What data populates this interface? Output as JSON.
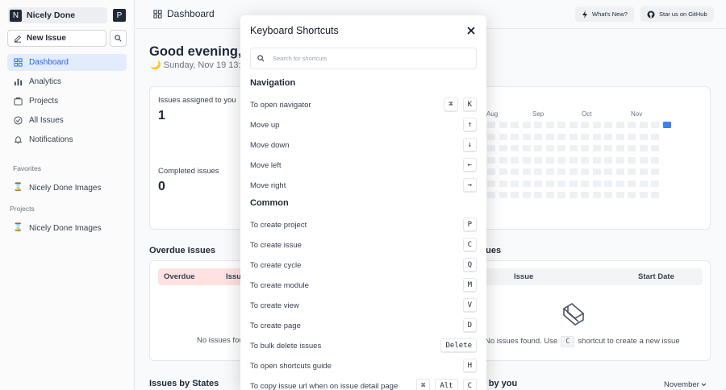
{
  "sidebar": {
    "workspace": {
      "initial": "N",
      "name": "Nicely Done"
    },
    "user_initial": "P",
    "new_issue": "New Issue",
    "nav": [
      {
        "label": "Dashboard",
        "icon": "grid-icon",
        "active": true
      },
      {
        "label": "Analytics",
        "icon": "bar-chart-icon"
      },
      {
        "label": "Projects",
        "icon": "briefcase-icon"
      },
      {
        "label": "All Issues",
        "icon": "check-circle-icon"
      },
      {
        "label": "Notifications",
        "icon": "bell-icon"
      }
    ],
    "favorites_label": "Favorites",
    "favorites": [
      {
        "label": "Nicely Done Images",
        "icon": "hourglass-icon"
      }
    ],
    "projects_label": "Projects",
    "projects": [
      {
        "label": "Nicely Done Images",
        "icon": "hourglass-icon"
      }
    ]
  },
  "topbar": {
    "title": "Dashboard",
    "whats_new": "What's New?",
    "github": "Star us on GitHub"
  },
  "dashboard": {
    "greeting": "Good evening, B",
    "date": "Sunday, Nov 19 13:38",
    "assigned_label": "Issues assigned to you",
    "assigned_value": "1",
    "completed_label": "Completed issues",
    "completed_value": "0",
    "months": [
      "Aug",
      "Sep",
      "Oct",
      "Nov"
    ],
    "heatmap_accent": "#3b82f6",
    "overdue_title": "Overdue Issues",
    "overdue_cols": [
      "Overdue",
      "Issue"
    ],
    "overdue_empty": "No issues found",
    "upcoming_title_fragment": "sues",
    "upcoming_cols": [
      "Issue",
      "Start Date"
    ],
    "upcoming_empty_pre": "No issues found. Use",
    "upcoming_empty_key": "C",
    "upcoming_empty_post": "shortcut to create a new issue",
    "states_title": "Issues by States",
    "by_you_fragment": "d by you",
    "month_select": "November"
  },
  "modal": {
    "title": "Keyboard Shortcuts",
    "search_placeholder": "Search for shortcuts",
    "groups": [
      {
        "title": "Navigation",
        "items": [
          {
            "label": "To open navigator",
            "keys": [
              "⌘",
              "K"
            ]
          },
          {
            "label": "Move up",
            "keys": [
              "↑"
            ]
          },
          {
            "label": "Move down",
            "keys": [
              "↓"
            ]
          },
          {
            "label": "Move left",
            "keys": [
              "←"
            ]
          },
          {
            "label": "Move right",
            "keys": [
              "→"
            ]
          }
        ]
      },
      {
        "title": "Common",
        "items": [
          {
            "label": "To create project",
            "keys": [
              "P"
            ]
          },
          {
            "label": "To create issue",
            "keys": [
              "C"
            ]
          },
          {
            "label": "To create cycle",
            "keys": [
              "Q"
            ]
          },
          {
            "label": "To create module",
            "keys": [
              "M"
            ]
          },
          {
            "label": "To create view",
            "keys": [
              "V"
            ]
          },
          {
            "label": "To create page",
            "keys": [
              "D"
            ]
          },
          {
            "label": "To bulk delete issues",
            "keys": [
              "Delete"
            ]
          },
          {
            "label": "To open shortcuts guide",
            "keys": [
              "H"
            ]
          },
          {
            "label": "To copy issue url when on issue detail page",
            "keys": [
              "⌘",
              "Alt",
              "C"
            ]
          }
        ]
      }
    ]
  }
}
